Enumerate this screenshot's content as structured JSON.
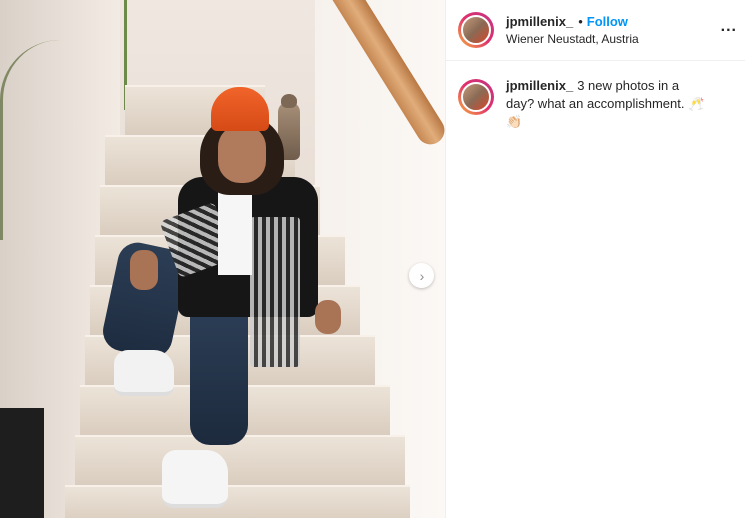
{
  "post": {
    "username": "jpmillenix_",
    "follow_label": "Follow",
    "dot": "•",
    "location": "Wiener Neustadt, Austria",
    "more_label": "...",
    "caption_username": "jpmillenix_",
    "caption_text": "3 new photos in a day? what an accomplishment. 🥂👏🏻",
    "next_icon": "chevron-right-icon"
  },
  "colors": {
    "follow": "#0095f6",
    "text": "#262626",
    "border": "#efefef"
  }
}
